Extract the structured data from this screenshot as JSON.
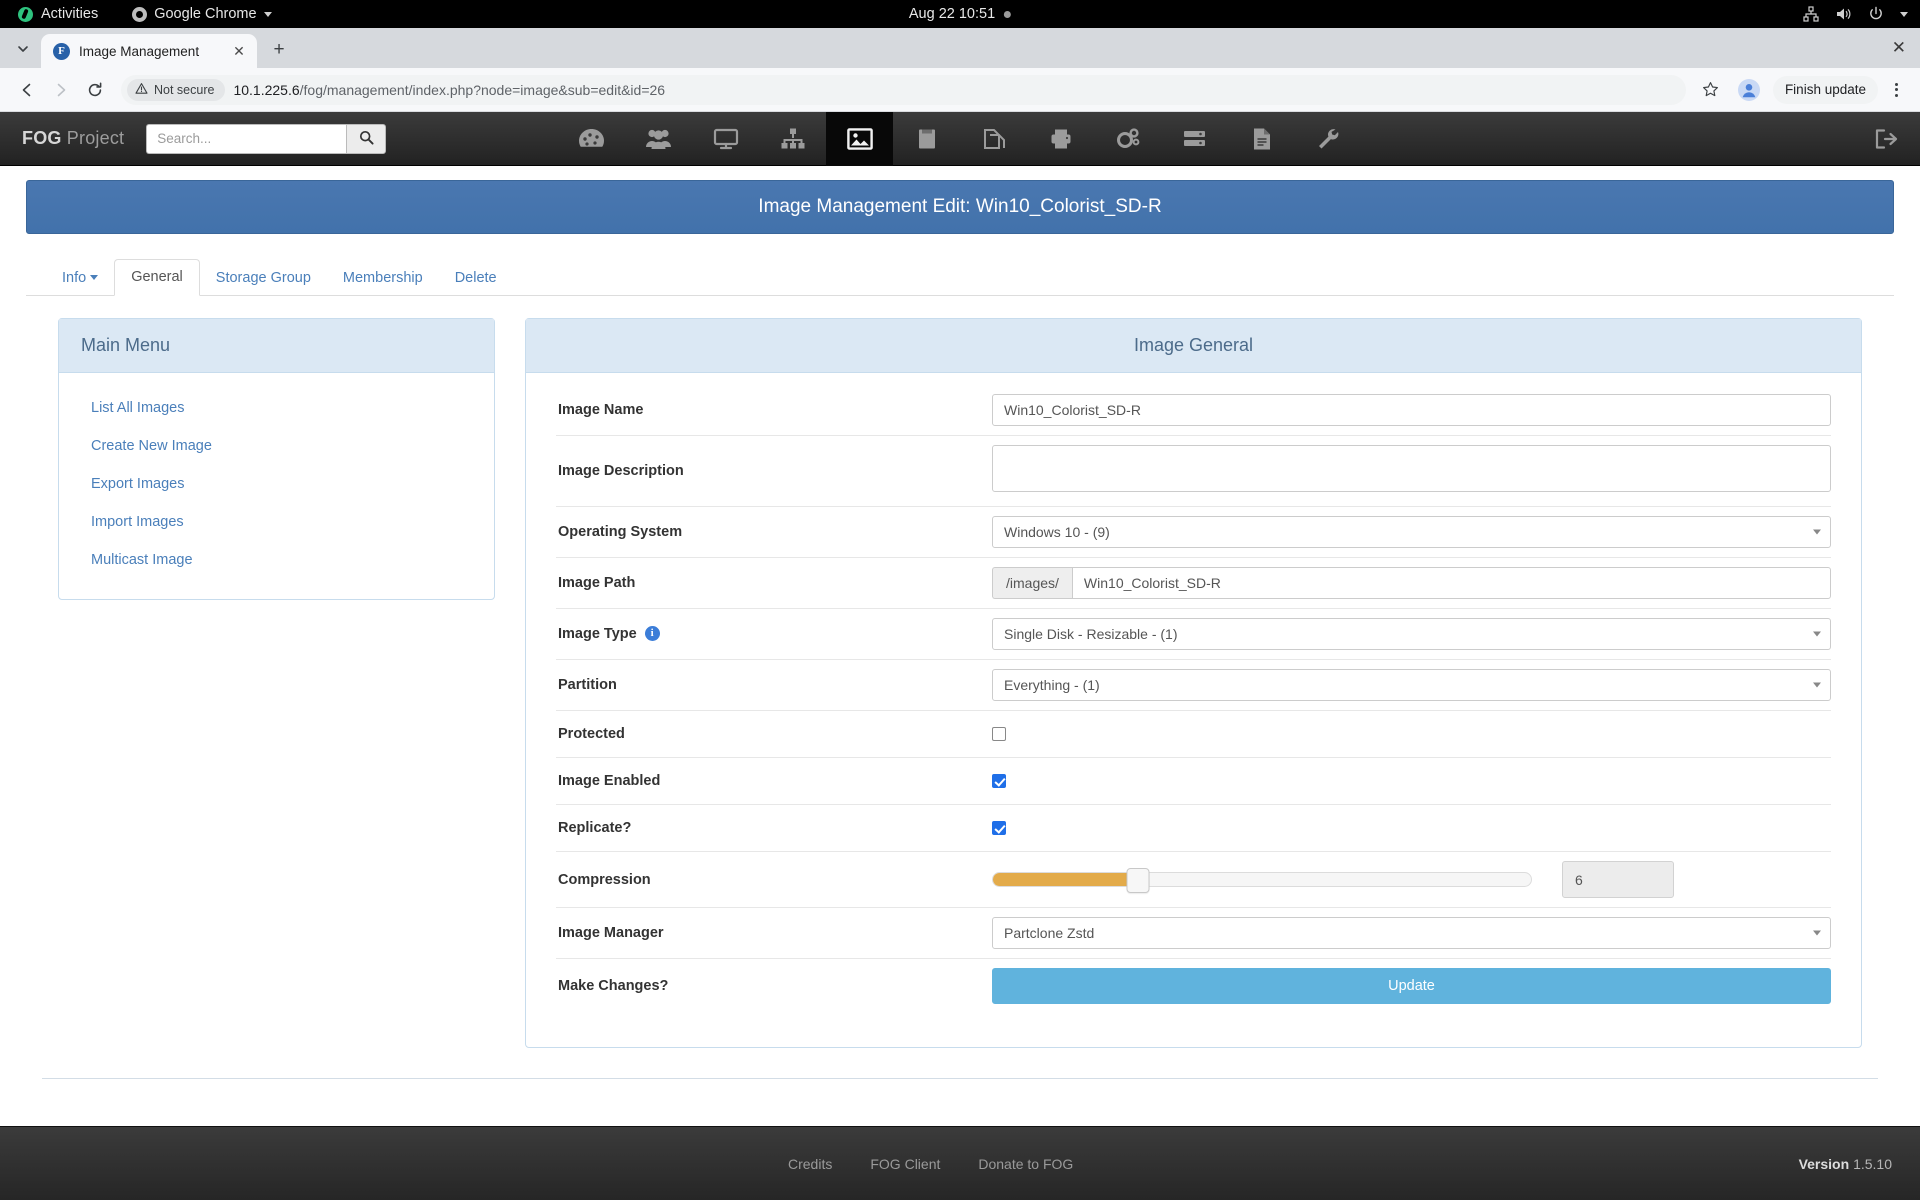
{
  "os_bar": {
    "activities": "Activities",
    "app_menu": "Google Chrome",
    "clock": "Aug 22  10:51",
    "icons": [
      "network-icon",
      "volume-icon",
      "power-icon",
      "chevron-down-icon"
    ]
  },
  "browser": {
    "tab": {
      "title": "Image Management",
      "favicon_letter": "F"
    },
    "new_tab_label": "+",
    "window_close_label": "✕",
    "omnibox": {
      "security_label": "Not secure",
      "url_host": "10.1.225.6",
      "url_path": "/fog/management/index.php?node=image&sub=edit&id=26"
    },
    "finish_update_label": "Finish update"
  },
  "fog_nav": {
    "brand_bold": "FOG",
    "brand_rest": " Project",
    "search_placeholder": "Search...",
    "search_value": "",
    "icons": [
      {
        "name": "dashboard-icon",
        "active": false
      },
      {
        "name": "users-icon",
        "active": false
      },
      {
        "name": "hosts-icon",
        "active": false
      },
      {
        "name": "groups-icon",
        "active": false
      },
      {
        "name": "images-icon",
        "active": true
      },
      {
        "name": "storage-icon",
        "active": false
      },
      {
        "name": "snapins-icon",
        "active": false
      },
      {
        "name": "printers-icon",
        "active": false
      },
      {
        "name": "settings-icon",
        "active": false
      },
      {
        "name": "tasks-icon",
        "active": false
      },
      {
        "name": "reports-icon",
        "active": false
      },
      {
        "name": "tools-icon",
        "active": false
      }
    ],
    "logout_icon": "logout-icon"
  },
  "page": {
    "title": "Image Management Edit: Win10_Colorist_SD-R",
    "tabs": [
      {
        "label": "Info",
        "active": false,
        "has_caret": true
      },
      {
        "label": "General",
        "active": true,
        "has_caret": false
      },
      {
        "label": "Storage Group",
        "active": false,
        "has_caret": false
      },
      {
        "label": "Membership",
        "active": false,
        "has_caret": false
      },
      {
        "label": "Delete",
        "active": false,
        "has_caret": false
      }
    ]
  },
  "sidebar": {
    "heading": "Main Menu",
    "items": [
      {
        "label": "List All Images"
      },
      {
        "label": "Create New Image"
      },
      {
        "label": "Export Images"
      },
      {
        "label": "Import Images"
      },
      {
        "label": "Multicast Image"
      }
    ]
  },
  "form": {
    "heading": "Image General",
    "image_name": {
      "label": "Image Name",
      "value": "Win10_Colorist_SD-R"
    },
    "image_description": {
      "label": "Image Description",
      "value": ""
    },
    "operating_system": {
      "label": "Operating System",
      "value": "Windows 10 - (9)"
    },
    "image_path": {
      "label": "Image Path",
      "prefix": "/images/",
      "value": "Win10_Colorist_SD-R"
    },
    "image_type": {
      "label": "Image Type",
      "value": "Single Disk - Resizable - (1)",
      "info_icon": "info-icon"
    },
    "partition": {
      "label": "Partition",
      "value": "Everything - (1)"
    },
    "protected": {
      "label": "Protected",
      "checked": false
    },
    "image_enabled": {
      "label": "Image Enabled",
      "checked": true
    },
    "replicate": {
      "label": "Replicate?",
      "checked": true
    },
    "compression": {
      "label": "Compression",
      "value": "6",
      "min": 0,
      "max": 22,
      "percent": 27
    },
    "image_manager": {
      "label": "Image Manager",
      "value": "Partclone Zstd"
    },
    "make_changes": {
      "label": "Make Changes?",
      "button_label": "Update"
    }
  },
  "footer": {
    "links": [
      "Credits",
      "FOG Client",
      "Donate to FOG"
    ],
    "version_label": "Version",
    "version_number": "1.5.10"
  },
  "colors": {
    "accent_blue": "#4a77b0",
    "panel_head": "#dbe8f4",
    "link_blue": "#4a7fba",
    "slider_fill": "#e3ab4a",
    "update_button": "#60b3dd",
    "checkbox_checked": "#1f6fe8"
  }
}
